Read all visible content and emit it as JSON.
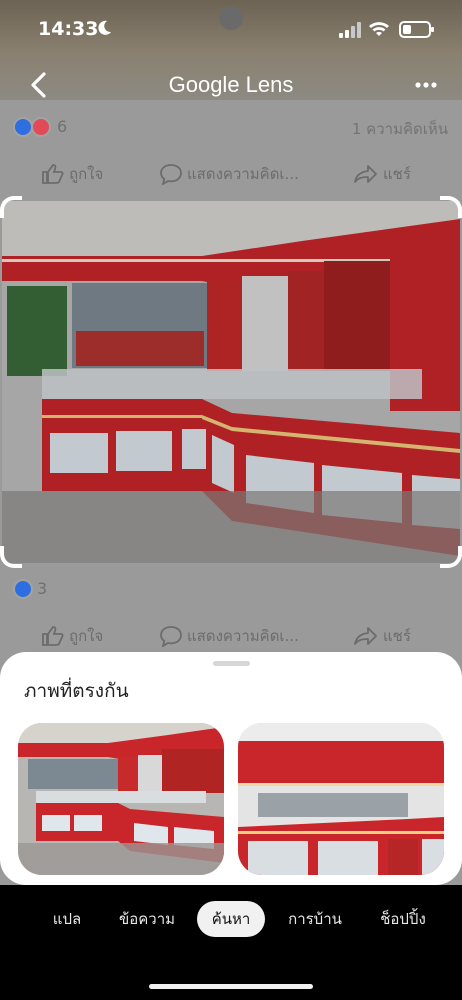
{
  "status_bar": {
    "time": "14:33",
    "icons": [
      "moon-icon",
      "signal-icon",
      "wifi-icon",
      "battery-icon"
    ]
  },
  "header": {
    "title": "Google Lens",
    "back_icon": "chevron-left-icon",
    "menu_icon": "more-horizontal-icon"
  },
  "post_top": {
    "reaction_count": "6",
    "comment_count": "1 ความคิดเห็น",
    "actions": {
      "like": "ถูกใจ",
      "comment": "แสดงความคิดเ...",
      "share": "แชร์"
    }
  },
  "post_bottom": {
    "reaction_count": "3",
    "actions": {
      "like": "ถูกใจ",
      "comment": "แสดงความคิดเ...",
      "share": "แชร์"
    }
  },
  "results": {
    "title": "ภาพที่ตรงกัน"
  },
  "bottom_nav": {
    "items": [
      "แปล",
      "ข้อความ",
      "ค้นหา",
      "การบ้าน",
      "ช็อปปิ้ง"
    ],
    "active": "ค้นหา"
  },
  "colors": {
    "accent_red": "#d42a2a",
    "sheet_bg": "#ffffff",
    "nav_bg": "#000000",
    "like_blue": "#2d6fe0",
    "love_red": "#e24a58"
  }
}
